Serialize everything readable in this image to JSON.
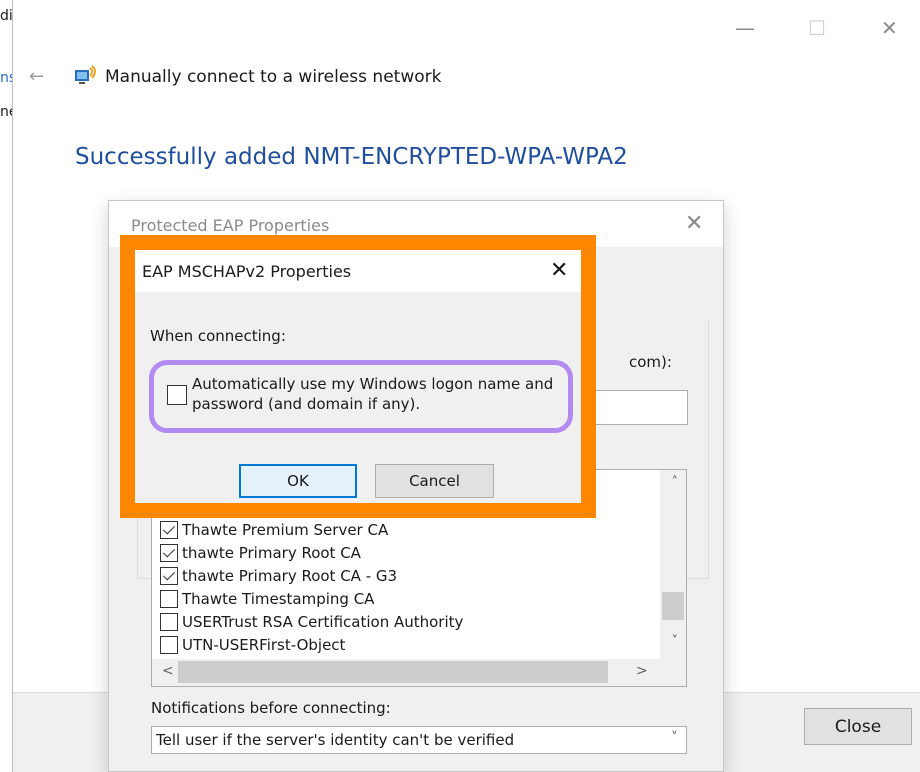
{
  "background_window": {
    "fragments": [
      "di",
      "ns",
      "ne"
    ]
  },
  "wizard": {
    "controls": {
      "minimize": "—",
      "maximize": "☐",
      "close": "✕"
    },
    "back_arrow": "←",
    "title": "Manually connect to a wireless network",
    "heading": "Successfully added NMT-ENCRYPTED-WPA-WPA2",
    "close_label": "Close"
  },
  "peap": {
    "title": "Protected EAP Properties",
    "close_glyph": "✕",
    "partial_label": "com):",
    "ca_list": [
      {
        "label": "Thawte Premium Server CA",
        "checked": true
      },
      {
        "label": "thawte Primary Root CA",
        "checked": true
      },
      {
        "label": "thawte Primary Root CA - G3",
        "checked": true
      },
      {
        "label": "Thawte Timestamping CA",
        "checked": false
      },
      {
        "label": "USERTrust RSA Certification Authority",
        "checked": false
      },
      {
        "label": "UTN-USERFirst-Object",
        "checked": false
      }
    ],
    "scroll": {
      "up": "˄",
      "down": "˅",
      "left": "<",
      "right": ">"
    },
    "notifications_label": "Notifications before connecting:",
    "notifications_value": "Tell user if the server's identity can't be verified",
    "select_chevron": "˅"
  },
  "mschap": {
    "title": "EAP MSCHAPv2 Properties",
    "close_glyph": "✕",
    "when_label": "When connecting:",
    "auto_logon_label": "Automatically use my Windows logon name and password (and domain if any).",
    "auto_logon_checked": false,
    "ok_label": "OK",
    "cancel_label": "Cancel"
  },
  "colors": {
    "accent_heading": "#1f4e9e",
    "highlight_orange": "#ff8600",
    "highlight_purple": "#b38af0",
    "focus_blue": "#0078d7"
  }
}
